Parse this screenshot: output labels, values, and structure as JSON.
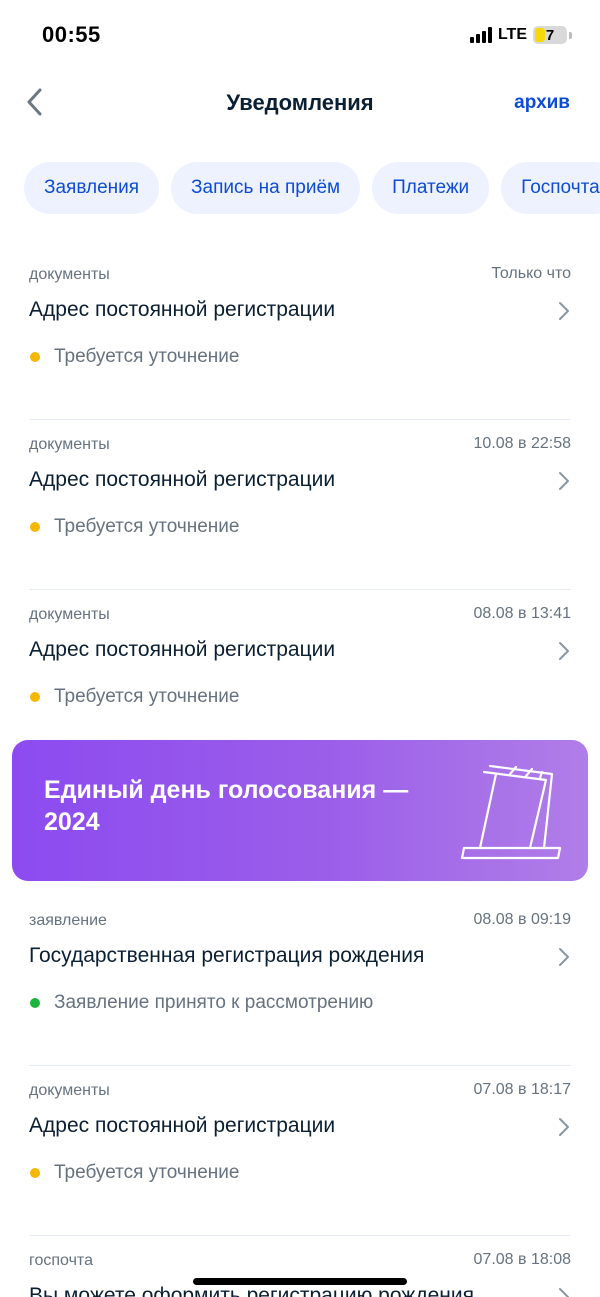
{
  "status_bar": {
    "time": "00:55",
    "network": "LTE",
    "battery": "7"
  },
  "nav": {
    "title": "Уведомления",
    "archive": "архив"
  },
  "chips": [
    "Заявления",
    "Запись на приём",
    "Платежи",
    "Госпочта"
  ],
  "colors": {
    "accent": "#0d4cd3",
    "warning": "#f5b700",
    "success": "#1bb53b",
    "banner_start": "#8c4bf0",
    "banner_end": "#b07ee8"
  },
  "notifications": [
    {
      "category": "документы",
      "time": "Только что",
      "title": "Адрес постоянной регистрации",
      "status": "Требуется уточнение",
      "status_color": "warning"
    },
    {
      "category": "документы",
      "time": "10.08 в 22:58",
      "title": "Адрес постоянной регистрации",
      "status": "Требуется уточнение",
      "status_color": "warning"
    },
    {
      "category": "документы",
      "time": "08.08 в 13:41",
      "title": "Адрес постоянной регистрации",
      "status": "Требуется уточнение",
      "status_color": "warning"
    }
  ],
  "banner": {
    "title": "Единый день голосования — 2024",
    "icon": "ballot-box-icon"
  },
  "notifications_after": [
    {
      "category": "заявление",
      "time": "08.08 в 09:19",
      "title": "Государственная регистрация рождения",
      "status": "Заявление принято к рассмотрению",
      "status_color": "success"
    },
    {
      "category": "документы",
      "time": "07.08 в 18:17",
      "title": "Адрес постоянной регистрации",
      "status": "Требуется уточнение",
      "status_color": "warning"
    },
    {
      "category": "госпочта",
      "time": "07.08 в 18:08",
      "title": "Вы можете оформить регистрацию рождения"
    }
  ]
}
